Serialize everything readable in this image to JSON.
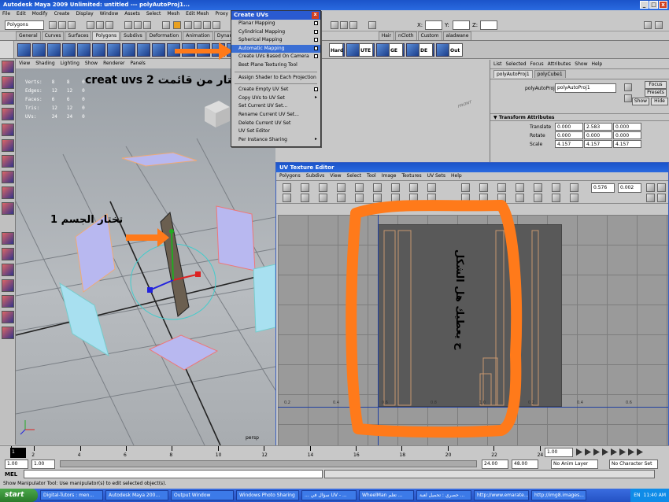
{
  "window": {
    "title": "Autodesk Maya 2009 Unlimited: untitled    ---    polyAutoProj1..."
  },
  "menubar": [
    "File",
    "Edit",
    "Modify",
    "Create",
    "Display",
    "Window",
    "Assets",
    "Select",
    "Mesh",
    "Edit Mesh",
    "Proxy",
    "Normals",
    "Color",
    "Help"
  ],
  "statusline": {
    "mode": "Polygons",
    "x_label": "X:",
    "y_label": "Y:",
    "z_label": "Z:"
  },
  "shelf_tabs": [
    "General",
    "Curves",
    "Surfaces",
    "Polygons",
    "Subdivs",
    "Deformation",
    "Animation",
    "Dynamics",
    "Rendering",
    "P",
    "Hair",
    "nCloth",
    "Custom",
    "aladwane"
  ],
  "shelf_labels": [
    "Hard",
    "UTE",
    "GE",
    "DE",
    "Out"
  ],
  "viewport": {
    "menu": [
      "View",
      "Shading",
      "Lighting",
      "Show",
      "Renderer",
      "Panels"
    ],
    "hud": [
      [
        "Verts:",
        "8",
        "8",
        "0"
      ],
      [
        "Edges:",
        "12",
        "12",
        "0"
      ],
      [
        "Faces:",
        "6",
        "6",
        "0"
      ],
      [
        "Tris:",
        "12",
        "12",
        "0"
      ],
      [
        "UVs:",
        "24",
        "24",
        "0"
      ]
    ],
    "camera": "persp",
    "viewcube": "FRONT"
  },
  "annotations": {
    "step1": "تختار الجسم 1",
    "step2": "تختار من قائمت creat uvs 2",
    "step3": "ح يعطيك هل الشكل"
  },
  "create_uvs_menu": {
    "title": "Create UVs",
    "items": [
      {
        "label": "Planar Mapping",
        "opt": true
      },
      {
        "label": "Cylindrical Mapping",
        "opt": true
      },
      {
        "label": "Spherical Mapping",
        "opt": true
      },
      {
        "label": "Automatic Mapping",
        "opt": true,
        "highlight": true
      },
      {
        "label": "Create UVs Based On Camera",
        "opt": true
      },
      {
        "label": "Best Plane Texturing Tool",
        "opt": false,
        "sep_after": true
      },
      {
        "label": "Assign Shader to Each Projection",
        "opt": false,
        "sep_after": true
      },
      {
        "label": "Create Empty UV Set",
        "opt": true
      },
      {
        "label": "Copy UVs to UV Set",
        "sub": true
      },
      {
        "label": "Set Current UV Set...",
        "opt": false
      },
      {
        "label": "Rename Current UV Set...",
        "opt": false
      },
      {
        "label": "Delete Current UV Set",
        "opt": false
      },
      {
        "label": "UV Set Editor",
        "opt": false
      },
      {
        "label": "Per Instance Sharing",
        "sub": true
      }
    ]
  },
  "attr_editor": {
    "menu": [
      "List",
      "Selected",
      "Focus",
      "Attributes",
      "Show",
      "Help"
    ],
    "tabs": [
      "polyAutoProj1",
      "polyCube1"
    ],
    "node_label": "polyAutoProj:",
    "node_value": "polyAutoProj1",
    "buttons": [
      "Focus",
      "Presets",
      "Show",
      "Hide"
    ],
    "section": "Transform Attributes",
    "rows": [
      {
        "label": "Translate",
        "v": [
          "0.000",
          "2.583",
          "0.000"
        ]
      },
      {
        "label": "Rotate",
        "v": [
          "0.000",
          "0.000",
          "0.000"
        ]
      },
      {
        "label": "Scale",
        "v": [
          "4.157",
          "4.157",
          "4.157"
        ]
      }
    ]
  },
  "uv_editor": {
    "title": "UV Texture Editor",
    "menu": [
      "Polygons",
      "Subdivs",
      "View",
      "Select",
      "Tool",
      "Image",
      "Textures",
      "UV Sets",
      "Help"
    ],
    "field1": "0.576",
    "field2": "0.002",
    "axis_labels": [
      "0.2",
      "0.4",
      "0.6",
      "0.8",
      "1.0",
      "0.2",
      "0.4",
      "0.6"
    ]
  },
  "timeline": {
    "ticks": [
      "1",
      "2",
      "4",
      "6",
      "8",
      "10",
      "12",
      "14",
      "16",
      "18",
      "20",
      "22",
      "24"
    ],
    "current": "1.00"
  },
  "range": {
    "start": "1.00",
    "start2": "1.00",
    "end": "24.00",
    "end2": "48.00",
    "anim_layer": "No Anim Layer",
    "char_set": "No Character Set"
  },
  "mel": {
    "label": "MEL"
  },
  "helpline": "Show Manipulator Tool: Use manipulator(s) to edit selected object(s).",
  "taskbar": {
    "start": "start",
    "tasks": [
      "Digital-Tutors : men...",
      "Autodesk Maya 200...",
      "Output Window",
      "Windows Photo Sharing",
      "... سؤال في UV - ...",
      "WheelMan تعلم ...",
      "حصري : تحميل لعبة ...",
      "http://www.emarate...",
      "http://img8.images..."
    ],
    "lang": "EN",
    "time": "11:40 AM"
  },
  "colors": {
    "accent": "#2a5ad0",
    "highlight_orange": "#ff7a1a",
    "uv_shell": "#6a5c50"
  }
}
